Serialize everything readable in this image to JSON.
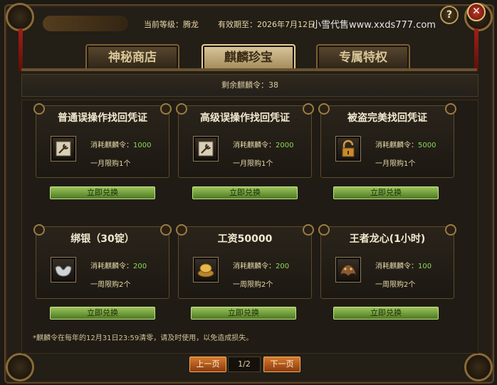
{
  "header": {
    "level_label": "当前等级：",
    "level_value": "腾龙",
    "expiry_label": "有效期至：",
    "expiry_value": "2026年7月12日",
    "watermark": "小雪代售www.xxds777.com",
    "help_symbol": "?",
    "close_symbol": "✕"
  },
  "tabs": [
    {
      "label": "神秘商店",
      "active": false
    },
    {
      "label": "麒麟珍宝",
      "active": true
    },
    {
      "label": "专属特权",
      "active": false
    }
  ],
  "remain": {
    "label": "剩余麒麟令：",
    "value": "38"
  },
  "cost_label": "消耗麒麟令：",
  "items": [
    {
      "title": "普通误操作找回凭证",
      "cost": "1000",
      "limit": "一月限购1个",
      "button": "立即兑换",
      "icon": "wrench-scroll-icon"
    },
    {
      "title": "高级误操作找回凭证",
      "cost": "2000",
      "limit": "一月限购1个",
      "button": "立即兑换",
      "icon": "wrench-scroll-icon"
    },
    {
      "title": "被盗完美找回凭证",
      "cost": "5000",
      "limit": "一月限购1个",
      "button": "立即兑换",
      "icon": "lock-icon"
    },
    {
      "title": "绑银（30锭）",
      "cost": "200",
      "limit": "一周限购2个",
      "button": "立即兑换",
      "icon": "silver-ingot-icon"
    },
    {
      "title": "工资50000",
      "cost": "200",
      "limit": "一周限购2个",
      "button": "立即兑换",
      "icon": "gold-ingot-icon"
    },
    {
      "title": "王者龙心(1小时)",
      "cost": "100",
      "limit": "一周限购2个",
      "button": "立即兑换",
      "icon": "dragon-heart-icon"
    }
  ],
  "note": "*麒麟令在每年的12月31日23:59清零，请及时使用，以免造成损失。",
  "pagination": {
    "prev": "上一页",
    "current": "1/2",
    "next": "下一页"
  },
  "colors": {
    "accent_gold": "#d9c79c",
    "cost_green": "#8ed85a",
    "button_green": "#6e9e36",
    "close_red": "#c23a26"
  }
}
